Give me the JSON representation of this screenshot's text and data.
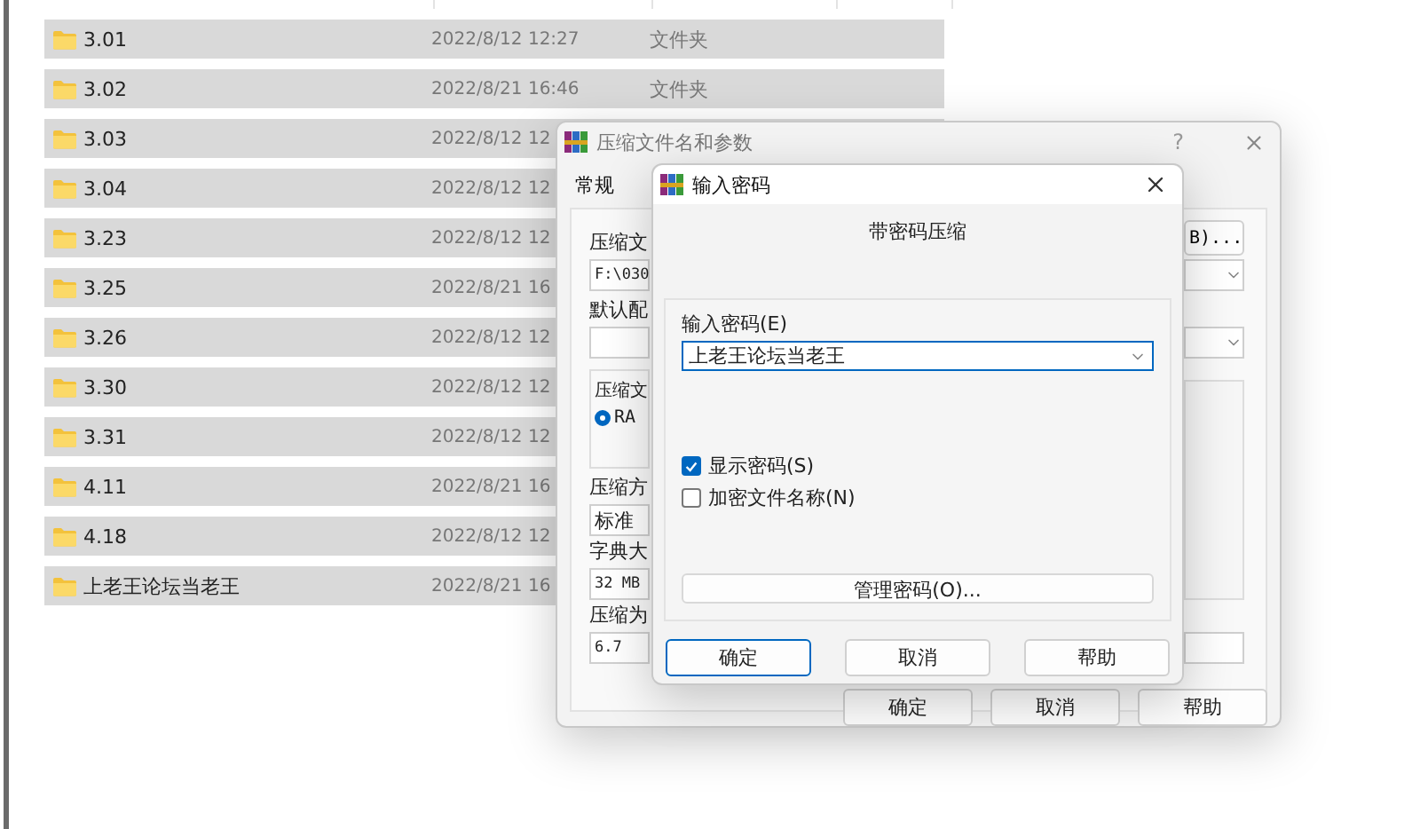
{
  "file_list": {
    "rows": [
      {
        "name": "3.01",
        "modified": "2022/8/12 12:27",
        "type": "文件夹",
        "selected": true
      },
      {
        "name": "3.02",
        "modified": "2022/8/21 16:46",
        "type": "文件夹",
        "selected": true
      },
      {
        "name": "3.03",
        "modified": "2022/8/12 12",
        "selected": true
      },
      {
        "name": "3.04",
        "modified": "2022/8/12 12",
        "selected": true
      },
      {
        "name": "3.23",
        "modified": "2022/8/12 12",
        "selected": true
      },
      {
        "name": "3.25",
        "modified": "2022/8/21 16",
        "selected": true
      },
      {
        "name": "3.26",
        "modified": "2022/8/12 12",
        "selected": true
      },
      {
        "name": "3.30",
        "modified": "2022/8/12 12",
        "selected": true
      },
      {
        "name": "3.31",
        "modified": "2022/8/12 12",
        "selected": true
      },
      {
        "name": "4.11",
        "modified": "2022/8/21 16",
        "selected": true
      },
      {
        "name": "4.18",
        "modified": "2022/8/12 12",
        "selected": true
      },
      {
        "name": "上老王论坛当老王",
        "modified": "2022/8/21 16",
        "selected": true
      }
    ]
  },
  "archive_dialog": {
    "title": "压缩文件名和参数",
    "help": "?",
    "tabs": [
      {
        "label": "常规",
        "selected": true
      }
    ],
    "archive_name_label": "压缩文",
    "browse_button": "B)...",
    "archive_name_value": "F:\\030",
    "profile_label": "默认配",
    "format_group": {
      "label": "压缩文",
      "options": [
        {
          "label": "RA",
          "selected": true
        }
      ]
    },
    "method_label": "压缩方",
    "method_value": "标准",
    "dictionary_label": "字典大",
    "dictionary_value": "32 MB",
    "split_label": "压缩为",
    "split_value": "6.7",
    "buttons": [
      "确定",
      "取消",
      "帮助"
    ]
  },
  "password_dialog": {
    "title": "输入密码",
    "heading": "带密码压缩",
    "password_label": "输入密码(E)",
    "password_value": "上老王论坛当老王",
    "options": [
      {
        "label": "显示密码(S)",
        "checked": true
      },
      {
        "label": "加密文件名称(N)",
        "checked": false
      }
    ],
    "manage_button": "管理密码(O)...",
    "buttons": [
      {
        "label": "确定",
        "default": true
      },
      {
        "label": "取消",
        "default": false
      },
      {
        "label": "帮助",
        "default": false
      }
    ]
  }
}
